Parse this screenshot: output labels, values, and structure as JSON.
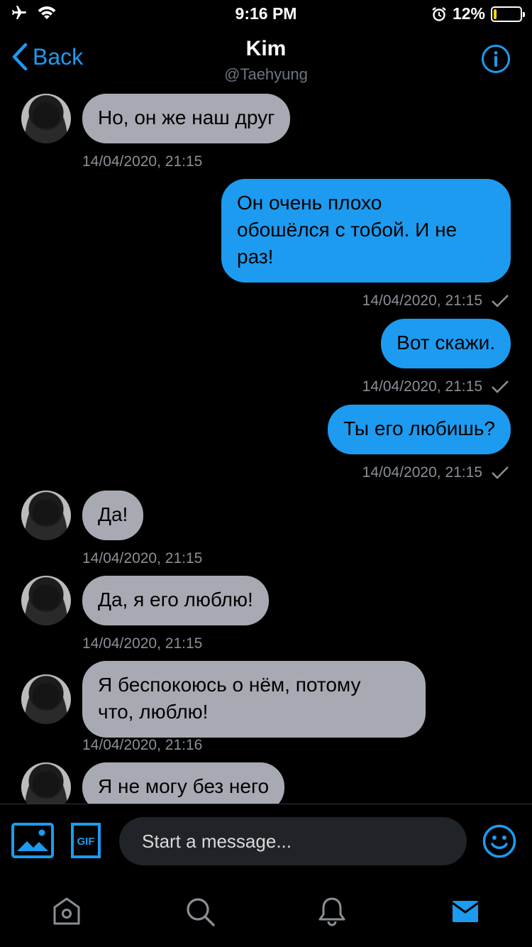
{
  "status_bar": {
    "time": "9:16 PM",
    "battery_percent": "12%",
    "battery_level": 0.12,
    "icons": [
      "airplane-icon",
      "wifi-icon",
      "alarm-icon",
      "battery-icon"
    ]
  },
  "header": {
    "back_label": "Back",
    "title": "Kim",
    "subtitle": "@Taehyung",
    "info_icon": "info-icon"
  },
  "messages": [
    {
      "direction": "in",
      "text": "Но, он же наш друг",
      "timestamp": "14/04/2020, 21:15"
    },
    {
      "direction": "out",
      "lines": [
        "Он очень плохо",
        "обошёлся с тобой. И не",
        "раз!"
      ],
      "timestamp": "14/04/2020, 21:15"
    },
    {
      "direction": "out",
      "text": "Вот скажи.",
      "timestamp": "14/04/2020, 21:15"
    },
    {
      "direction": "out",
      "text": "Ты его любишь?",
      "timestamp": "14/04/2020, 21:15"
    },
    {
      "direction": "in",
      "text": "Да!",
      "timestamp": "14/04/2020, 21:15"
    },
    {
      "direction": "in",
      "text": "Да, я его люблю!",
      "timestamp": "14/04/2020, 21:15"
    },
    {
      "direction": "in",
      "lines": [
        "Я беспокоюсь о нём, потому",
        "что, люблю!"
      ],
      "timestamp": "14/04/2020, 21:16"
    },
    {
      "direction": "in",
      "text": "Я не могу без него"
    }
  ],
  "composer": {
    "placeholder": "Start a message...",
    "gif_label": "GIF"
  },
  "tabbar": [
    "home-icon",
    "search-icon",
    "notifications-icon",
    "messages-icon"
  ],
  "colors": {
    "accent": "#1d9bf0",
    "incoming_bubble": "#a8aab3",
    "timestamp": "#8a8f96",
    "background": "#000000"
  }
}
